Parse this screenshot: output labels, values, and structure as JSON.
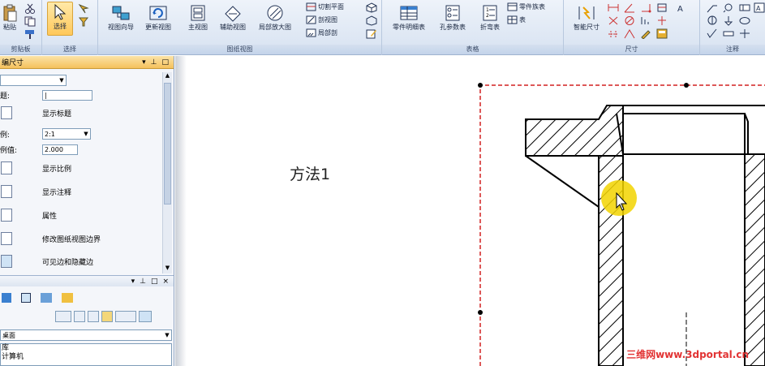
{
  "ribbon": {
    "clipboard": {
      "paste_label": "粘贴",
      "group_label": "剪贴板"
    },
    "select": {
      "select_label": "选择",
      "group_label": "选择"
    },
    "drawing_views": {
      "view_wizard": "视图向导",
      "update_views": "更新视图",
      "principal_view": "主视图",
      "auxiliary_view": "辅助视图",
      "detail_view": "局部放大图",
      "cutting_plane": "切割平面",
      "section_view": "剖视图",
      "partial_section": "局部剖",
      "group_label": "图纸视图"
    },
    "tables": {
      "parts_list": "零件明细表",
      "hole_table": "孔参数表",
      "bend_table": "折弯表",
      "parts_list_small": "零件族表",
      "table_small": "表",
      "group_label": "表格"
    },
    "dimension": {
      "smart_dimension": "智能尺寸",
      "group_label": "尺寸"
    },
    "annotation": {
      "group_label": "注释"
    }
  },
  "panel": {
    "title": "编尺寸",
    "rows": {
      "title_field_label": "题:",
      "title_field_value": "|",
      "show_title": "显示标题",
      "scale_label": "例:",
      "scale_value": "2:1",
      "scale_val_label": "例值:",
      "scale_val_value": "2.000",
      "show_scale": "显示比例",
      "show_annotation": "显示注释",
      "properties": "属性",
      "modify_border": "修改图纸视图边界",
      "visible_hidden_edges": "可见边和隐藏边"
    },
    "lower": {
      "location": "桌面",
      "tree_item_1": "库",
      "tree_item_2": "计算机"
    }
  },
  "canvas": {
    "method_label": "方法1",
    "watermark": "三维网www.3dportal.cn"
  },
  "colors": {
    "ribbon_bg": "#dce6f3",
    "active_button": "#ffc85a",
    "sheet_border": "#d22020",
    "highlight": "#f2d400"
  }
}
